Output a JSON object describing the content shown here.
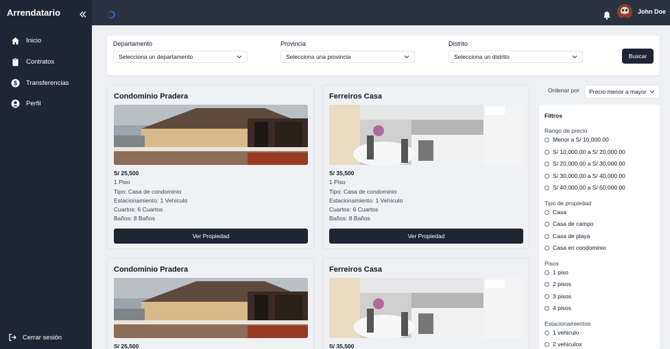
{
  "sidebar": {
    "brand": "Arrendatario",
    "items": [
      {
        "label": "Inicio",
        "icon": "home-icon"
      },
      {
        "label": "Contratos",
        "icon": "clipboard-icon"
      },
      {
        "label": "Transferencias",
        "icon": "dollar-icon"
      },
      {
        "label": "Perfil",
        "icon": "user-icon"
      }
    ],
    "logout_label": "Cerrar sesión"
  },
  "topbar": {
    "user_name": "John Doe"
  },
  "filters_bar": {
    "departamento": {
      "label": "Departamento",
      "value": "Selecciona un departamento"
    },
    "provincia": {
      "label": "Provincia",
      "value": "Selecciona una provincia"
    },
    "distrito": {
      "label": "Distrito",
      "value": "Selecciona un distrito"
    },
    "search_button": "Buscar"
  },
  "cards": [
    {
      "title": "Condominio Pradera",
      "price": "S/ 25,500",
      "floors": "1 Piso",
      "type": "Tipo: Casa de condominio",
      "parking": "Estacionamiento: 1 Vehículo",
      "rooms": "Cuartos: 6 Cuartos",
      "baths": "Baños: 8 Baños",
      "button": "Ver Propiedad",
      "image": "house-exterior"
    },
    {
      "title": "Ferreiros Casa",
      "price": "S/ 35,500",
      "floors": "1 Piso",
      "type": "Tipo: Casa de condominio",
      "parking": "Estacionamiento: 1 Vehículo",
      "rooms": "Cuartos: 6 Cuartos",
      "baths": "Baños: 8 Baños",
      "button": "Ver Propiedad",
      "image": "kitchen-interior"
    },
    {
      "title": "Condominio Pradera",
      "price": "S/ 25,500",
      "image": "house-exterior"
    },
    {
      "title": "Ferreiros Casa",
      "price": "S/ 35,500",
      "image": "kitchen-interior"
    }
  ],
  "sort": {
    "label": "Ordenar por",
    "value": "Precio menor a mayor"
  },
  "filters_panel": {
    "title": "Filtros",
    "price_range": {
      "title": "Rango de precio",
      "options": [
        "Menor a S/ 10,000.00",
        "S/ 10,000.00 a S/ 20,000.00",
        "S/ 20,000.00 a S/ 30,000.00",
        "S/ 30,000.00 a S/ 40,000.00",
        "S/ 40,000.00 a S/ 50,000.00"
      ]
    },
    "property_type": {
      "title": "Tipo de propiedad",
      "options": [
        "Casa",
        "Casa de campo",
        "Casa de playa",
        "Casa en condominio"
      ]
    },
    "floors": {
      "title": "Pisos",
      "options": [
        "1 piso",
        "2 pisos",
        "3 pisos",
        "4 pisos"
      ]
    },
    "parking": {
      "title": "Estacionamientos",
      "options": [
        "1 vehiculo",
        "2 vehiculos"
      ]
    }
  },
  "colors": {
    "sidebar_bg": "#1e2533",
    "topbar_bg": "#2b3240",
    "primary_button": "#1e2533",
    "page_bg": "#eef0f3"
  }
}
